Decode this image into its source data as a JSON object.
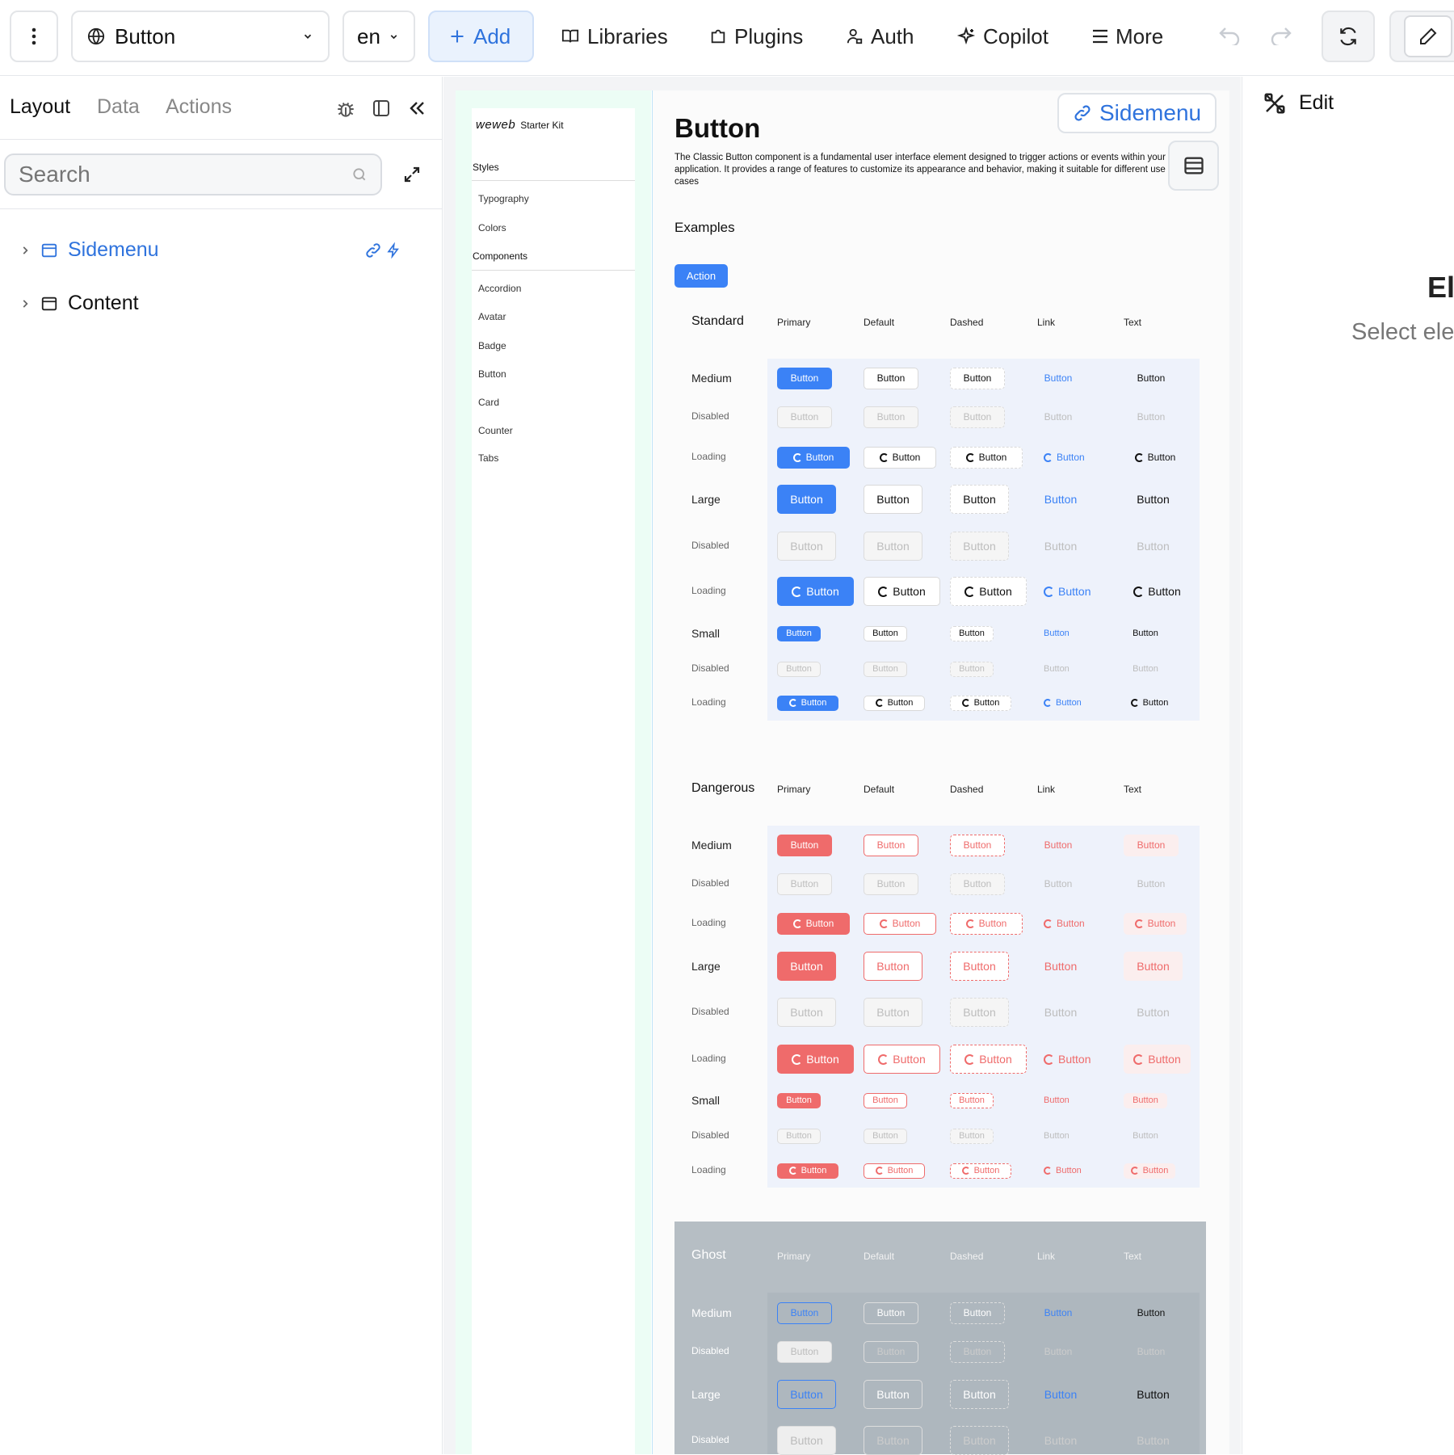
{
  "toolbar": {
    "page_select": "Button",
    "language": "en",
    "add_label": "Add",
    "libraries_label": "Libraries",
    "plugins_label": "Plugins",
    "auth_label": "Auth",
    "copilot_label": "Copilot",
    "more_label": "More"
  },
  "left_panel": {
    "tabs": [
      "Layout",
      "Data",
      "Actions"
    ],
    "search_placeholder": "Search",
    "tree": [
      {
        "label": "Sidemenu",
        "linked": true
      },
      {
        "label": "Content",
        "linked": false
      }
    ]
  },
  "canvas": {
    "sidebar": {
      "logo": "weweb",
      "kit_label": "Starter Kit",
      "styles_header": "Styles",
      "styles": [
        "Typography",
        "Colors"
      ],
      "components_header": "Components",
      "components": [
        "Accordion",
        "Avatar",
        "Badge",
        "Button",
        "Card",
        "Counter",
        "Tabs"
      ]
    },
    "selection_badge": "Sidemenu",
    "page_title": "Button",
    "description": "The Classic Button component is a fundamental user interface element designed to trigger actions or events within your application. It provides a range of features to customize its appearance and behavior, making it suitable for different use cases",
    "examples_label": "Examples",
    "action_button": "Action",
    "columns": [
      "Primary",
      "Default",
      "Dashed",
      "Link",
      "Text"
    ],
    "button_text": "Button",
    "sections": [
      {
        "title": "Standard",
        "rows": [
          "Medium",
          "Disabled",
          "Loading",
          "Large",
          "Disabled",
          "Loading",
          "Small",
          "Disabled",
          "Loading"
        ]
      },
      {
        "title": "Dangerous",
        "rows": [
          "Medium",
          "Disabled",
          "Loading",
          "Large",
          "Disabled",
          "Loading",
          "Small",
          "Disabled",
          "Loading"
        ]
      },
      {
        "title": "Ghost",
        "rows": [
          "Medium",
          "Disabled",
          "Large",
          "Disabled"
        ]
      }
    ]
  },
  "right_panel": {
    "edit_label": "Edit",
    "empty_title": "El",
    "empty_hint": "Select ele"
  },
  "colors": {
    "primary": "#3b82f6",
    "danger": "#ef6b6b",
    "ghost_bg": "#b6bec4"
  }
}
